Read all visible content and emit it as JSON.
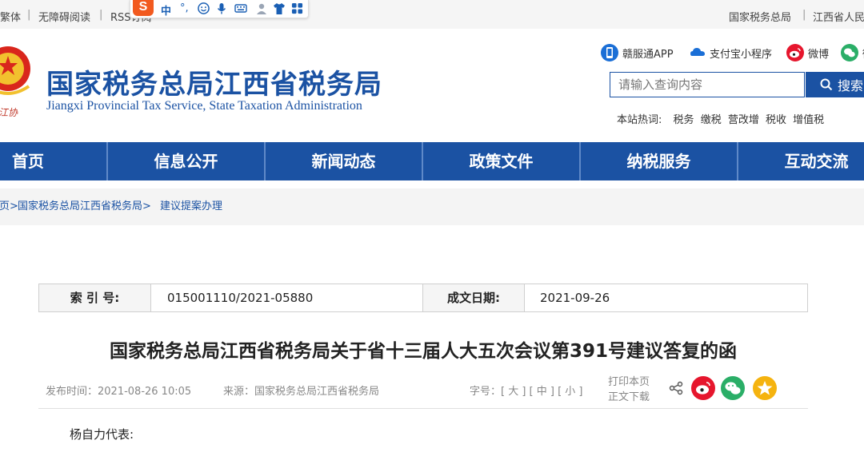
{
  "topbar": {
    "traditional": "繁体",
    "accessible": "无障碍阅读",
    "rss": "RSS订阅",
    "right_link_1": "国家税务总局",
    "right_link_2": "江西省人民"
  },
  "ime": {
    "logo": "S",
    "mode": "中",
    "punct": "°,"
  },
  "header": {
    "title_cn": "国家税务总局江西省税务局",
    "title_en": "Jiangxi Provincial Tax Service, State Taxation Administration",
    "emblem_text": "江协",
    "links": {
      "app": "赣服通APP",
      "alipay": "支付宝小程序",
      "weibo": "微博",
      "wechat": "微"
    },
    "search": {
      "placeholder": "请输入查询内容",
      "button": "搜索"
    },
    "hotwords_label": "本站热词:",
    "hotwords": [
      "税务",
      "缴税",
      "营改增",
      "税收",
      "增值税"
    ]
  },
  "nav": [
    "首页",
    "信息公开",
    "新闻动态",
    "政策文件",
    "纳税服务",
    "互动交流"
  ],
  "breadcrumb": {
    "home": "首页>",
    "bureau": "国家税务总局江西省税务局>",
    "section": "建议提案办理"
  },
  "info": {
    "index_label": "索 引 号:",
    "index_value": "015001110/2021-05880",
    "date_label": "成文日期:",
    "date_value": "2021-09-26"
  },
  "article": {
    "title": "国家税务总局江西省税务局关于省十三届人大五次会议第391号建议答复的函",
    "published": "发布时间：2021-08-26 10:05",
    "source": "来源：国家税务总局江西省税务局",
    "fontsize": "字号：[ 大 ] [ 中 ] [ 小 ]",
    "print": "打印本页",
    "download": "正文下载",
    "greeting": "杨自力代表:"
  },
  "colors": {
    "brand_blue": "#1b52a3",
    "weibo_red": "#e6162d",
    "wechat_green": "#2aae67",
    "qzone_yellow": "#f5b30f"
  }
}
